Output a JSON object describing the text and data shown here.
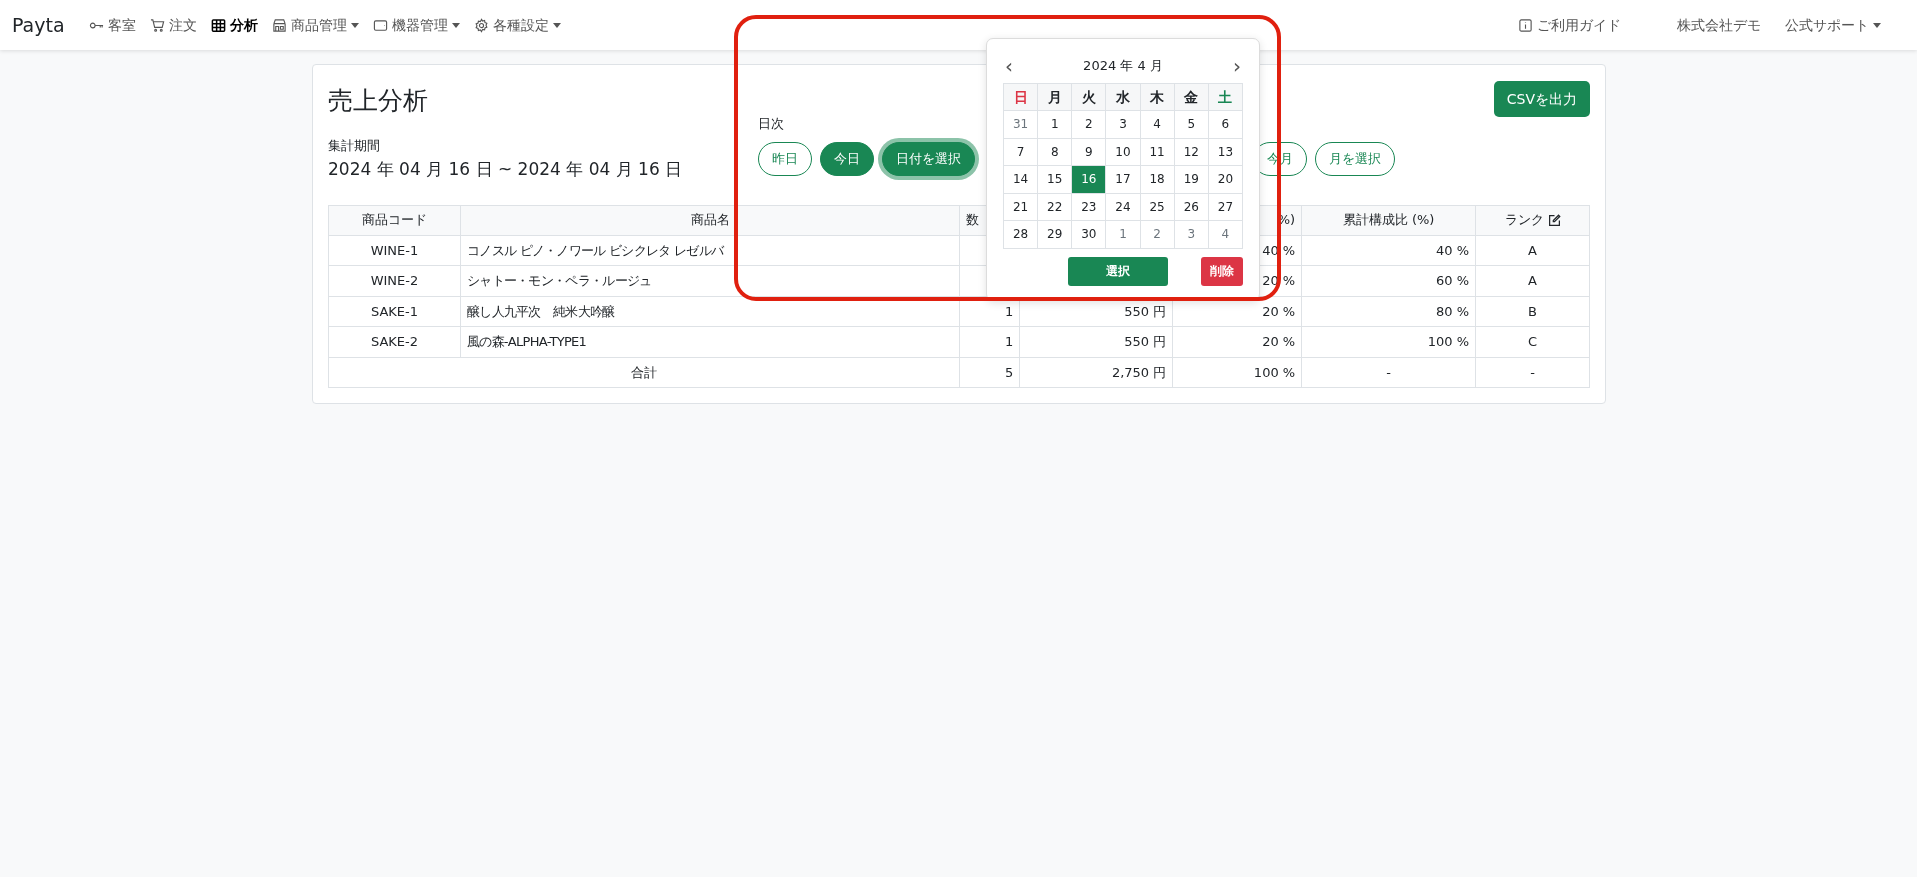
{
  "navbar": {
    "brand": "Payta",
    "items": [
      {
        "label": "客室",
        "selected": false,
        "dropdown": false
      },
      {
        "label": "注文",
        "selected": false,
        "dropdown": false
      },
      {
        "label": "分析",
        "selected": true,
        "dropdown": false
      },
      {
        "label": "商品管理",
        "selected": false,
        "dropdown": true
      },
      {
        "label": "機器管理",
        "selected": false,
        "dropdown": true
      },
      {
        "label": "各種設定",
        "selected": false,
        "dropdown": true
      }
    ],
    "right": [
      {
        "label": "ご利用ガイド",
        "dropdown": false
      },
      {
        "label": "株式会社デモ",
        "dropdown": false
      },
      {
        "label": "公式サポート",
        "dropdown": true
      }
    ]
  },
  "page": {
    "title": "売上分析",
    "period_label": "集計期間",
    "period": "2024 年 04 月 16 日 ~ 2024 年 04 月 16 日",
    "export_button": "CSVを出力",
    "filter_groups": [
      {
        "label": "日次",
        "buttons": [
          {
            "label": "昨日",
            "selected": false
          },
          {
            "label": "今日",
            "selected": true
          },
          {
            "label": "日付を選択",
            "selected": true,
            "focused": true
          }
        ]
      },
      {
        "buttons": [
          {
            "label": "今月",
            "selected": false
          },
          {
            "label": "月を選択",
            "selected": false
          }
        ]
      }
    ]
  },
  "table": {
    "columns": [
      "商品コード",
      "商品名",
      "数",
      null,
      "%)",
      "累計構成比 (%)",
      "ランク"
    ],
    "rows": [
      [
        "WINE-1",
        "コノスル ピノ・ノワール ビシクレタ レゼルバ",
        null,
        null,
        "40 %",
        "40 %",
        "A"
      ],
      [
        "WINE-2",
        "シャトー・モン・ペラ・ルージュ",
        null,
        null,
        "20 %",
        "60 %",
        "A"
      ],
      [
        "SAKE-1",
        "醸し人九平次　純米大吟醸",
        "1",
        "550 円",
        "20 %",
        "80 %",
        "B"
      ],
      [
        "SAKE-2",
        "風の森-ALPHA-TYPE1",
        "1",
        "550 円",
        "20 %",
        "100 %",
        "C"
      ]
    ],
    "total": {
      "label": "合計",
      "cells": [
        "5",
        "2,750 円",
        "100 %",
        "-",
        "-"
      ]
    }
  },
  "calendar": {
    "month": "2024 年 4 月",
    "prev": "‹",
    "next": "›",
    "weekdays": [
      {
        "label": "日",
        "color": "#dc3545"
      },
      {
        "label": "月",
        "color": "#212529"
      },
      {
        "label": "火",
        "color": "#212529"
      },
      {
        "label": "水",
        "color": "#212529"
      },
      {
        "label": "木",
        "color": "#212529"
      },
      {
        "label": "金",
        "color": "#212529"
      },
      {
        "label": "土",
        "color": "#198754"
      }
    ],
    "weeks": [
      [
        {
          "day": "31",
          "muted": true,
          "selected": false
        },
        {
          "day": "1",
          "muted": false,
          "selected": false
        },
        {
          "day": "2",
          "muted": false,
          "selected": false
        },
        {
          "day": "3",
          "muted": false,
          "selected": false
        },
        {
          "day": "4",
          "muted": false,
          "selected": false
        },
        {
          "day": "5",
          "muted": false,
          "selected": false
        },
        {
          "day": "6",
          "muted": false,
          "selected": false
        }
      ],
      [
        {
          "day": "7",
          "muted": false,
          "selected": false
        },
        {
          "day": "8",
          "muted": false,
          "selected": false
        },
        {
          "day": "9",
          "muted": false,
          "selected": false
        },
        {
          "day": "10",
          "muted": false,
          "selected": false
        },
        {
          "day": "11",
          "muted": false,
          "selected": false
        },
        {
          "day": "12",
          "muted": false,
          "selected": false
        },
        {
          "day": "13",
          "muted": false,
          "selected": false
        }
      ],
      [
        {
          "day": "14",
          "muted": false,
          "selected": false
        },
        {
          "day": "15",
          "muted": false,
          "selected": false
        },
        {
          "day": "16",
          "muted": false,
          "selected": true
        },
        {
          "day": "17",
          "muted": false,
          "selected": false
        },
        {
          "day": "18",
          "muted": false,
          "selected": false
        },
        {
          "day": "19",
          "muted": false,
          "selected": false
        },
        {
          "day": "20",
          "muted": false,
          "selected": false
        }
      ],
      [
        {
          "day": "21",
          "muted": false,
          "selected": false
        },
        {
          "day": "22",
          "muted": false,
          "selected": false
        },
        {
          "day": "23",
          "muted": false,
          "selected": false
        },
        {
          "day": "24",
          "muted": false,
          "selected": false
        },
        {
          "day": "25",
          "muted": false,
          "selected": false
        },
        {
          "day": "26",
          "muted": false,
          "selected": false
        },
        {
          "day": "27",
          "muted": false,
          "selected": false
        }
      ],
      [
        {
          "day": "28",
          "muted": false,
          "selected": false
        },
        {
          "day": "29",
          "muted": false,
          "selected": false
        },
        {
          "day": "30",
          "muted": false,
          "selected": false
        },
        {
          "day": "1",
          "muted": true,
          "selected": false
        },
        {
          "day": "2",
          "muted": true,
          "selected": false
        },
        {
          "day": "3",
          "muted": true,
          "selected": false
        },
        {
          "day": "4",
          "muted": true,
          "selected": false
        }
      ]
    ],
    "select_button": "選択",
    "delete_button": "削除"
  },
  "highlight_frame": true
}
